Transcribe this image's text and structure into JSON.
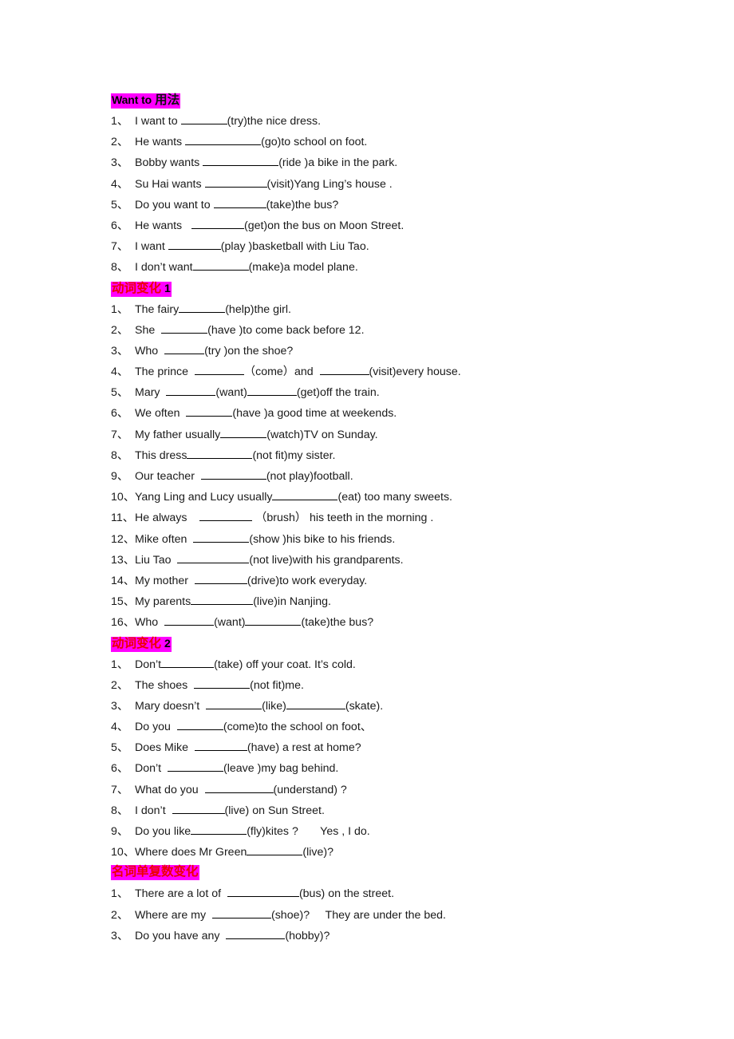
{
  "document": {
    "background_color": "#ffffff",
    "highlight_color": "#ff00ff",
    "heading_red": "#ee0000",
    "text_color": "#1a1a1a"
  },
  "sections": [
    {
      "id": "want-to",
      "heading": {
        "parts": [
          {
            "text": "Want to",
            "style": "en-black"
          },
          {
            "text": "用法",
            "style": "cn-black"
          }
        ],
        "full_text": "Want to 用法"
      },
      "items": [
        {
          "num": "1、",
          "before": "I want to ",
          "blank": 58,
          "after": "(try)the nice dress."
        },
        {
          "num": "2、",
          "before": "He wants ",
          "blank": 95,
          "after": "(go)to school on foot."
        },
        {
          "num": "3、",
          "before": "Bobby wants ",
          "blank": 95,
          "after": "(ride )a bike in the park."
        },
        {
          "num": "4、",
          "before": "Su Hai wants ",
          "blank": 78,
          "after": "(visit)Yang Ling’s house ."
        },
        {
          "num": "5、",
          "before": "Do you want to ",
          "blank": 66,
          "after": "(take)the bus?"
        },
        {
          "num": "6、",
          "before": "He wants   ",
          "blank": 66,
          "after": "(get)on the bus on Moon Street."
        },
        {
          "num": "7、",
          "before": "I want ",
          "blank": 66,
          "after": "(play )basketball with Liu Tao."
        },
        {
          "num": "8、",
          "before": "I don’t want",
          "blank": 70,
          "after": "(make)a model plane."
        }
      ]
    },
    {
      "id": "verb-change-1",
      "heading": {
        "parts": [
          {
            "text": "动词变化",
            "style": "cn-red"
          },
          {
            "text": "1",
            "style": "num-black"
          }
        ],
        "full_text": "动词变化 1"
      },
      "items": [
        {
          "num": "1、",
          "before": "The fairy",
          "blank": 58,
          "after": "(help)the girl."
        },
        {
          "num": "2、",
          "before": "She  ",
          "blank": 58,
          "after": "(have )to come back before 12."
        },
        {
          "num": "3、",
          "before": "Who  ",
          "blank": 50,
          "after": "(try )on the shoe?"
        },
        {
          "num": "4、",
          "before": "The prince  ",
          "blank": 62,
          "after": "（come）and  ",
          "blank2": 62,
          "after2": "(visit)every house."
        },
        {
          "num": "5、",
          "before": "Mary  ",
          "blank": 62,
          "after": "(want)",
          "blank2": 62,
          "after2": "(get)off the train."
        },
        {
          "num": "6、",
          "before": "We often  ",
          "blank": 58,
          "after": "(have )a good time at weekends."
        },
        {
          "num": "7、",
          "before": "My father usually",
          "blank": 58,
          "after": "(watch)TV on Sunday."
        },
        {
          "num": "8、",
          "before": "This dress",
          "blank": 82,
          "after": "(not fit)my sister."
        },
        {
          "num": "9、",
          "before": "Our teacher  ",
          "blank": 82,
          "after": "(not play)football."
        },
        {
          "num": "10、",
          "before": "Yang Ling and Lucy usually",
          "blank": 82,
          "after": "(eat) too many sweets."
        },
        {
          "num": "11、",
          "before": "He always    ",
          "blank": 66,
          "after": " （brush） his teeth in the morning ."
        },
        {
          "num": "12、",
          "before": "Mike often  ",
          "blank": 70,
          "after": "(show )his bike to his friends."
        },
        {
          "num": "13、",
          "before": "Liu Tao  ",
          "blank": 90,
          "after": "(not live)with his grandparents."
        },
        {
          "num": "14、",
          "before": "My mother  ",
          "blank": 66,
          "after": "(drive)to work everyday."
        },
        {
          "num": "15、",
          "before": "My parents",
          "blank": 78,
          "after": "(live)in Nanjing."
        },
        {
          "num": "16、",
          "before": "Who  ",
          "blank": 62,
          "after": "(want)",
          "blank2": 70,
          "after2": "(take)the bus?"
        }
      ]
    },
    {
      "id": "verb-change-2",
      "heading": {
        "parts": [
          {
            "text": "动词变化",
            "style": "cn-red"
          },
          {
            "text": "2",
            "style": "num-black"
          }
        ],
        "full_text": "动词变化 2"
      },
      "items": [
        {
          "num": "1、",
          "before": "Don’t",
          "blank": 66,
          "after": "(take) off your coat. It’s cold."
        },
        {
          "num": "2、",
          "before": "The shoes  ",
          "blank": 70,
          "after": "(not fit)me."
        },
        {
          "num": "3、",
          "before": "Mary doesn’t  ",
          "blank": 70,
          "after": "(like)",
          "blank2": 74,
          "after2": "(skate)."
        },
        {
          "num": "4、",
          "before": "Do you  ",
          "blank": 58,
          "after": "(come)to the school on foot、"
        },
        {
          "num": "5、",
          "before": "Does Mike  ",
          "blank": 66,
          "after": "(have) a rest at home?"
        },
        {
          "num": "6、",
          "before": "Don’t  ",
          "blank": 70,
          "after": "(leave )my bag behind."
        },
        {
          "num": "7、",
          "before": "What do you  ",
          "blank": 86,
          "after": "(understand) ?"
        },
        {
          "num": "8、",
          "before": "I don’t  ",
          "blank": 66,
          "after": "(live) on Sun Street."
        },
        {
          "num": "9、",
          "before": "Do you like",
          "blank": 70,
          "after": "(fly)kites ?       Yes , I do."
        },
        {
          "num": "10、",
          "before": "Where does Mr Green",
          "blank": 70,
          "after": "(live)?"
        }
      ]
    },
    {
      "id": "noun-plural",
      "heading": {
        "parts": [
          {
            "text": "名词单复数变化",
            "style": "cn-red"
          }
        ],
        "full_text": "名词单复数变化"
      },
      "items": [
        {
          "num": "1、",
          "before": "There are a lot of  ",
          "blank": 90,
          "after": "(bus) on the street."
        },
        {
          "num": "2、",
          "before": "Where are my  ",
          "blank": 74,
          "after": "(shoe)?     They are under the bed."
        },
        {
          "num": "3、",
          "before": "Do you have any  ",
          "blank": 74,
          "after": "(hobby)?"
        }
      ]
    }
  ]
}
